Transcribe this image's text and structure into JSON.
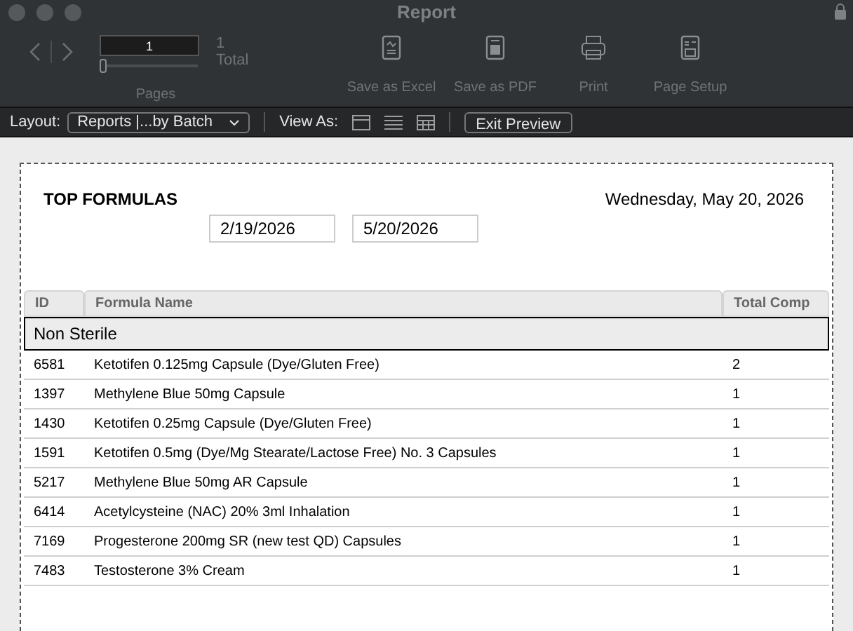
{
  "window": {
    "title": "Report"
  },
  "toolbar": {
    "page_field": {
      "value": "1"
    },
    "page_slider": {
      "level": 0.0
    },
    "total_count": "1",
    "total_label": "Total",
    "pages_label": "Pages",
    "actions": [
      {
        "kind": "excel",
        "label": "Save as Excel",
        "disabled": true
      },
      {
        "kind": "pdf",
        "label": "Save as PDF",
        "disabled": true
      },
      {
        "kind": "print",
        "label": "Print",
        "disabled": true
      },
      {
        "kind": "setup",
        "label": "Page Setup",
        "disabled": true
      }
    ]
  },
  "layout_bar": {
    "layout_label": "Layout:",
    "layout_value": "Reports |...by Batch",
    "view_as_label": "View As:",
    "view_modes": [
      {
        "kind": "form"
      },
      {
        "kind": "list"
      },
      {
        "kind": "table"
      }
    ],
    "exit_button": "Exit Preview"
  },
  "report": {
    "title": "TOP FORMULAS",
    "date": "Wednesday, May 20, 2026",
    "start_date": "2/19/2026",
    "end_date": "5/20/2026",
    "columns": [
      "ID",
      "Formula Name",
      "Total Comp"
    ],
    "group": "Non Sterile",
    "rows": [
      {
        "id": "6581",
        "name": "Ketotifen 0.125mg Capsule (Dye/Gluten Free)",
        "total": "2"
      },
      {
        "id": "1397",
        "name": "Methylene Blue 50mg Capsule",
        "total": "1"
      },
      {
        "id": "1430",
        "name": "Ketotifen 0.25mg Capsule (Dye/Gluten Free)",
        "total": "1"
      },
      {
        "id": "1591",
        "name": "Ketotifen 0.5mg (Dye/Mg Stearate/Lactose Free) No. 3 Capsules",
        "total": "1"
      },
      {
        "id": "5217",
        "name": "Methylene Blue 50mg AR Capsule",
        "total": "1"
      },
      {
        "id": "6414",
        "name": "Acetylcysteine (NAC) 20% 3ml Inhalation",
        "total": "1"
      },
      {
        "id": "7169",
        "name": "Progesterone 200mg SR (new test QD) Capsules",
        "total": "1"
      },
      {
        "id": "7483",
        "name": "Testosterone 3% Cream",
        "total": "1"
      }
    ]
  }
}
